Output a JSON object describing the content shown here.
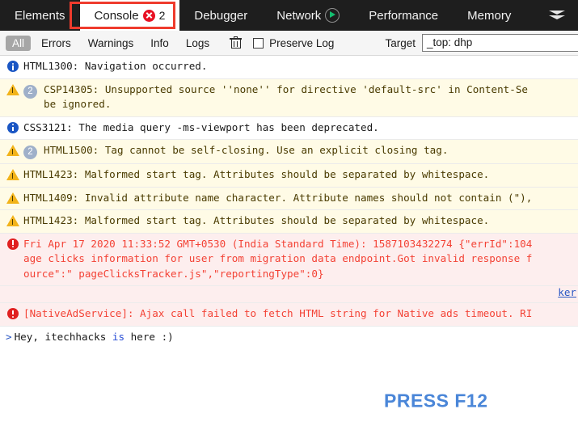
{
  "tabs": [
    {
      "label": "Elements",
      "active": false,
      "icon": "none"
    },
    {
      "label": "Console",
      "active": true,
      "icon": "error-badge",
      "error_count": "2"
    },
    {
      "label": "Debugger",
      "active": false,
      "icon": "none"
    },
    {
      "label": "Network",
      "active": false,
      "icon": "play-circle-icon"
    },
    {
      "label": "Performance",
      "active": false,
      "icon": "none"
    },
    {
      "label": "Memory",
      "active": false,
      "icon": "none"
    }
  ],
  "tab_overflow_icon": "double-chevron-down-icon",
  "toolbar": {
    "filters": [
      {
        "label": "All",
        "selected": true
      },
      {
        "label": "Errors",
        "selected": false
      },
      {
        "label": "Warnings",
        "selected": false
      },
      {
        "label": "Info",
        "selected": false
      },
      {
        "label": "Logs",
        "selected": false
      }
    ],
    "clear_icon": "trash-icon",
    "preserve_log_label": "Preserve Log",
    "preserve_log_checked": false,
    "target_label": "Target",
    "target_value": "_top: dhp"
  },
  "console_entries": [
    {
      "level": "info",
      "icon": "info-icon",
      "count": "",
      "lines": [
        "HTML1300: Navigation occurred."
      ]
    },
    {
      "level": "warn",
      "icon": "warning-icon",
      "count": "2",
      "lines": [
        "CSP14305: Unsupported source ''none'' for directive 'default-src' in Content-Se",
        "be ignored."
      ]
    },
    {
      "level": "info",
      "icon": "info-icon",
      "count": "",
      "lines": [
        "CSS3121: The media query -ms-viewport has been deprecated."
      ]
    },
    {
      "level": "warn",
      "icon": "warning-icon",
      "count": "2",
      "lines": [
        "HTML1500: Tag cannot be self-closing. Use an explicit closing tag."
      ]
    },
    {
      "level": "warn",
      "icon": "warning-icon",
      "count": "",
      "lines": [
        "HTML1423: Malformed start tag. Attributes should be separated by whitespace."
      ]
    },
    {
      "level": "warn",
      "icon": "warning-icon",
      "count": "",
      "lines": [
        "HTML1409: Invalid attribute name character. Attribute names should not contain (\"),"
      ]
    },
    {
      "level": "warn",
      "icon": "warning-icon",
      "count": "",
      "lines": [
        "HTML1423: Malformed start tag. Attributes should be separated by whitespace."
      ]
    },
    {
      "level": "error",
      "icon": "error-icon",
      "count": "",
      "lines": [
        "Fri Apr 17 2020 11:33:52 GMT+0530 (India Standard Time): 1587103432274 {\"errId\":104",
        "age clicks information for user from migration data endpoint.Got invalid response f",
        "ource\":\" pageClicksTracker.js\",\"reportingType\":0}"
      ],
      "source_link": "ker"
    },
    {
      "level": "error",
      "icon": "error-icon",
      "count": "",
      "lines": [
        "[NativeAdService]: Ajax call failed to fetch HTML string for Native ads timeout. RI"
      ]
    }
  ],
  "prompt": {
    "caret": ">",
    "parts": [
      {
        "text": "Hey, itechhacks ",
        "keyword": false
      },
      {
        "text": "is",
        "keyword": true
      },
      {
        "text": " here :)",
        "keyword": false
      }
    ]
  },
  "watermark": "PRESS F12",
  "colors": {
    "tabbar_bg": "#1e1e1e",
    "active_tab_bg": "#ffffff",
    "highlight_box": "#ef3b2d",
    "warn_bg": "#fffbe6",
    "error_bg": "#fdeeee",
    "error_text": "#f34235",
    "link": "#2a57c4",
    "watermark": "#4a86d8"
  }
}
